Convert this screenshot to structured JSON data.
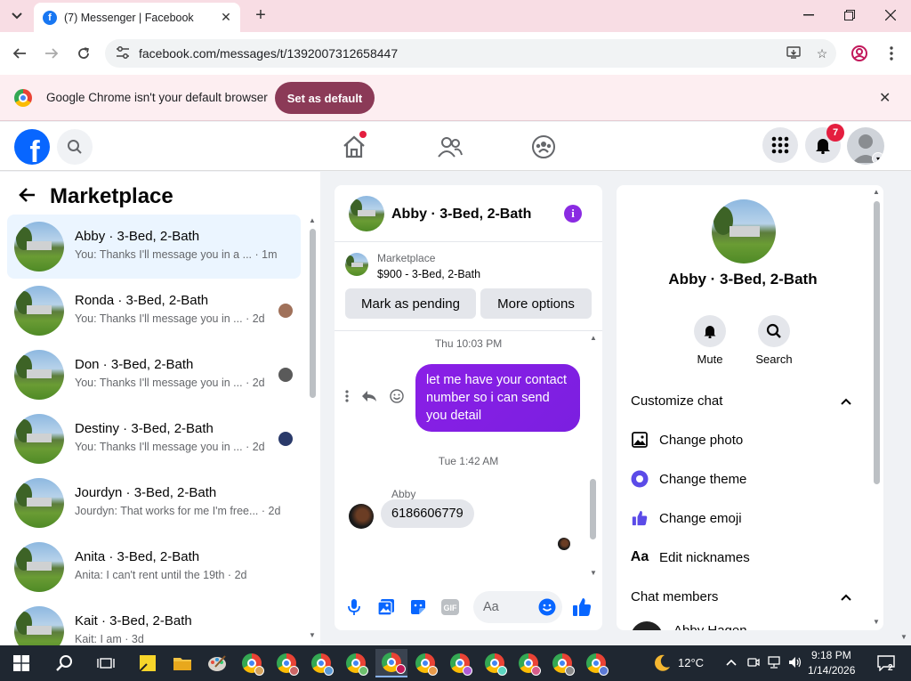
{
  "browser": {
    "tab_title": "(7) Messenger | Facebook",
    "url": "facebook.com/messages/t/1392007312658447",
    "infobar_text": "Google Chrome isn't your default browser",
    "set_default_label": "Set as default"
  },
  "fb_header": {
    "notification_count": "7"
  },
  "left_pane": {
    "title": "Marketplace",
    "conversations": [
      {
        "name": "Abby · 3-Bed, 2-Bath",
        "preview": "You: Thanks I'll message you in a ... · 1m",
        "active": true
      },
      {
        "name": "Ronda · 3-Bed, 2-Bath",
        "preview": "You: Thanks I'll message you in ... · 2d"
      },
      {
        "name": "Don · 3-Bed, 2-Bath",
        "preview": "You: Thanks I'll message you in ... · 2d"
      },
      {
        "name": "Destiny · 3-Bed, 2-Bath",
        "preview": "You: Thanks I'll message you in ... · 2d"
      },
      {
        "name": "Jourdyn · 3-Bed, 2-Bath",
        "preview": "Jourdyn: That works for me I'm free... · 2d"
      },
      {
        "name": "Anita · 3-Bed, 2-Bath",
        "preview": "Anita: I can't rent until the 19th · 2d"
      },
      {
        "name": "Kait · 3-Bed, 2-Bath",
        "preview": "Kait: I am · 3d"
      }
    ]
  },
  "chat": {
    "header_name": "Abby · 3-Bed, 2-Bath",
    "listing_label": "Marketplace",
    "listing_price": "$900 - 3-Bed, 2-Bath",
    "mark_pending_label": "Mark as pending",
    "more_options_label": "More options",
    "timestamp_1": "Thu 10:03 PM",
    "outgoing_message": "let me have your contact number so i can send you detail",
    "timestamp_2": "Tue 1:42 AM",
    "sender_name": "Abby",
    "incoming_message": "6186606779",
    "composer_placeholder": "Aa"
  },
  "info_panel": {
    "name": "Abby · 3-Bed, 2-Bath",
    "mute_label": "Mute",
    "search_label": "Search",
    "customize_heading": "Customize chat",
    "change_photo": "Change photo",
    "change_theme": "Change theme",
    "change_emoji": "Change emoji",
    "edit_nicknames": "Edit nicknames",
    "members_heading": "Chat members",
    "member_name": "Abby Hagen"
  },
  "taskbar": {
    "temperature": "12°C",
    "time": "9:18 PM",
    "date": "1/14/2026",
    "notification_count": "2"
  },
  "colors": {
    "fb_blue": "#0866ff",
    "message_purple": "#8a1fe6",
    "set_default_bg": "#8b3a57",
    "tabstrip_bg": "#f8dde4"
  }
}
